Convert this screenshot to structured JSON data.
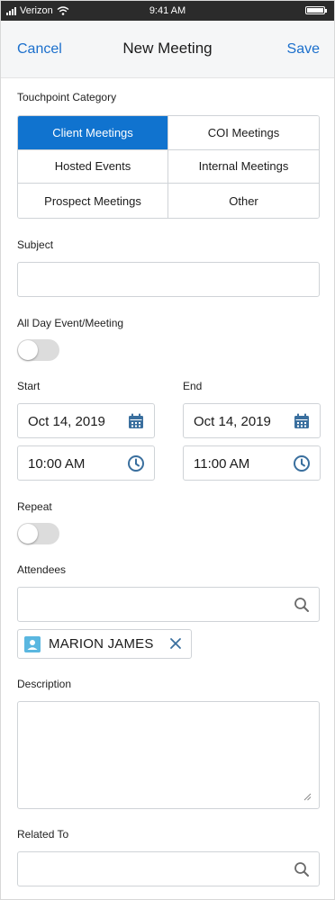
{
  "status_bar": {
    "carrier": "Verizon",
    "time": "9:41 AM"
  },
  "nav": {
    "cancel": "Cancel",
    "title": "New Meeting",
    "save": "Save"
  },
  "touchpoint": {
    "label": "Touchpoint Category",
    "options": [
      "Client Meetings",
      "COI Meetings",
      "Hosted Events",
      "Internal Meetings",
      "Prospect Meetings",
      "Other"
    ],
    "selected": "Client Meetings"
  },
  "subject": {
    "label": "Subject",
    "value": ""
  },
  "all_day": {
    "label": "All Day Event/Meeting",
    "on": false
  },
  "start": {
    "label": "Start",
    "date": "Oct 14, 2019",
    "time": "10:00 AM"
  },
  "end": {
    "label": "End",
    "date": "Oct 14, 2019",
    "time": "11:00 AM"
  },
  "repeat": {
    "label": "Repeat",
    "on": false
  },
  "attendees": {
    "label": "Attendees",
    "value": "",
    "chips": [
      "MARION JAMES"
    ]
  },
  "description": {
    "label": "Description",
    "value": ""
  },
  "related_to": {
    "label": "Related To",
    "value": ""
  },
  "colors": {
    "accent": "#1073cf",
    "link": "#1b6fcc",
    "icon": "#3a6f9e",
    "avatar": "#5ab7e0"
  },
  "icons": [
    "signal-icon",
    "wifi-icon",
    "battery-icon",
    "calendar-icon",
    "clock-icon",
    "search-icon",
    "contact-icon",
    "close-icon",
    "resize-grip-icon"
  ]
}
